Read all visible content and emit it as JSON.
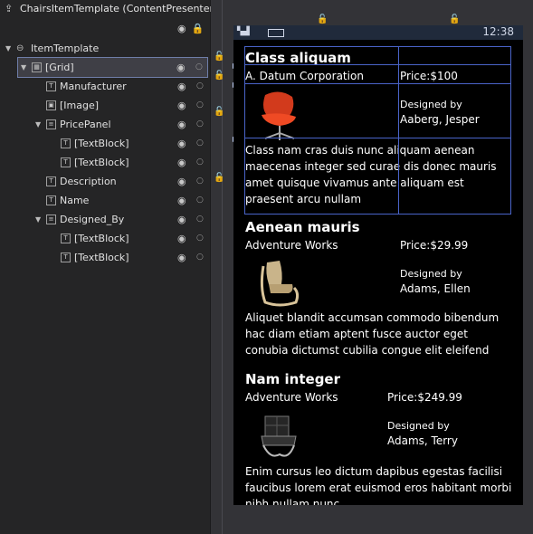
{
  "panel": {
    "title": "ChairsItemTemplate (ContentPresenter...",
    "tree": [
      {
        "label": "ItemTemplate"
      },
      {
        "label": "[Grid]"
      },
      {
        "label": "Manufacturer"
      },
      {
        "label": "[Image]"
      },
      {
        "label": "PricePanel"
      },
      {
        "label": "[TextBlock]"
      },
      {
        "label": "[TextBlock]"
      },
      {
        "label": "Description"
      },
      {
        "label": "Name"
      },
      {
        "label": "Designed_By"
      },
      {
        "label": "[TextBlock]"
      },
      {
        "label": "[TextBlock]"
      }
    ]
  },
  "phone": {
    "clock": "12:38",
    "items": [
      {
        "name": "Class aliquam",
        "manufacturer": "A. Datum Corporation",
        "price": "Price:$100",
        "designed_label": "Designed by",
        "designer": "Aaberg, Jesper",
        "description": "Class nam cras duis nunc aliquam aenean maecenas integer sed curae dis donec mauris amet quisque vivamus ante aliquam est praesent arcu nullam"
      },
      {
        "name": "Aenean mauris",
        "manufacturer": "Adventure Works",
        "price": "Price:$29.99",
        "designed_label": "Designed by",
        "designer": "Adams, Ellen",
        "description": "Aliquet blandit accumsan commodo bibendum hac diam etiam aptent fusce auctor eget conubia dictumst cubilia congue elit eleifend"
      },
      {
        "name": "Nam integer",
        "manufacturer": "Adventure Works",
        "price": "Price:$249.99",
        "designed_label": "Designed by",
        "designer": "Adams, Terry",
        "description": "Enim cursus leo dictum dapibus egestas facilisi faucibus lorem erat euismod eros habitant morbi nibh nullam nunc"
      }
    ]
  },
  "colors": {
    "panel_bg": "#252526",
    "selection_outline": "#6f7ea8",
    "grid_lines": "#4a64c9",
    "lock": "#e8c36a"
  }
}
